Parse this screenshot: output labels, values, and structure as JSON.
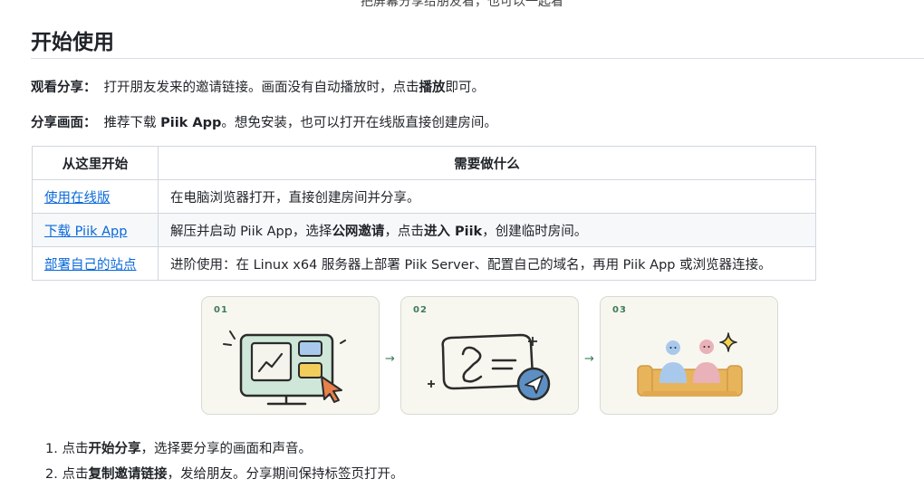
{
  "top_clip": "把屏幕分享给朋友看，也可以一起看",
  "section_title": "开始使用",
  "watch": {
    "label": "观看分享：",
    "text_before": "打开朋友发来的邀请链接。画面没有自动播放时，点击",
    "bold": "播放",
    "text_after": "即可。"
  },
  "share": {
    "label": "分享画面：",
    "text_before": "推荐下载 ",
    "bold": "Piik App",
    "text_after": "。想免安装，也可以打开在线版直接创建房间。"
  },
  "table": {
    "headers": [
      "从这里开始",
      "需要做什么"
    ],
    "rows": [
      {
        "link": "使用在线版",
        "desc_plain": "在电脑浏览器打开，直接创建房间并分享。"
      },
      {
        "link": "下载 Piik App",
        "desc_a": "解压并启动 Piik App，选择",
        "desc_b1": "公网邀请",
        "desc_c": "，点击",
        "desc_b2": "进入 Piik",
        "desc_d": "，创建临时房间。"
      },
      {
        "link": "部署自己的站点",
        "desc_plain": "进阶使用：在 Linux x64 服务器上部署 Piik Server、配置自己的域名，再用 Piik App 或浏览器连接。"
      }
    ]
  },
  "cards": [
    {
      "num": "01",
      "icon": "monitor-share-icon"
    },
    {
      "num": "02",
      "icon": "invite-link-send-icon"
    },
    {
      "num": "03",
      "icon": "friends-sofa-icon"
    }
  ],
  "arrow_glyph": "→",
  "steps": [
    {
      "prefix": "1. 点击",
      "bold": "开始分享",
      "suffix": "，选择要分享的画面和声音。"
    },
    {
      "prefix": "2. 点击",
      "bold": "复制邀请链接",
      "suffix": "，发给朋友。分享期间保持标签页打开。"
    }
  ],
  "colors": {
    "accent": "#3d7d56",
    "link": "#0969da",
    "card_bg": "#f7f7f0"
  }
}
